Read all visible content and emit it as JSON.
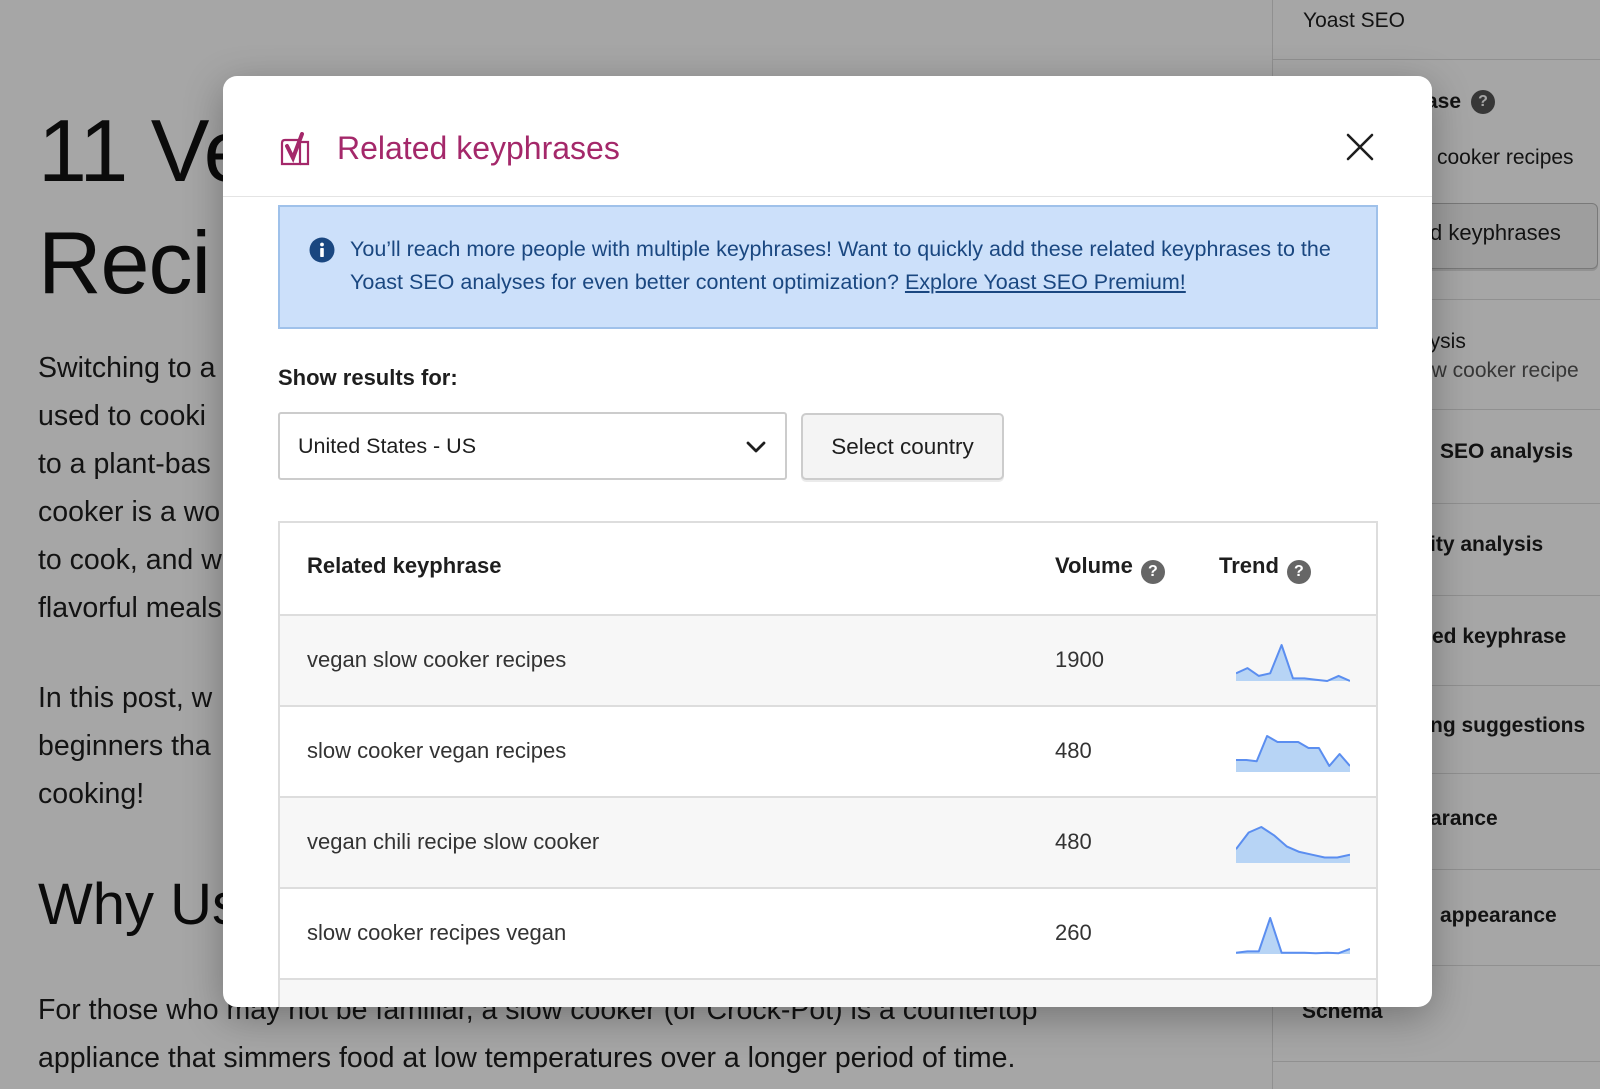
{
  "editor": {
    "title_line1": "11 Ve",
    "title_line2": "Reci",
    "p1_lines": [
      "Switching to a",
      "used to cooki",
      "to a plant-bas",
      "cooker is a wo",
      "to cook, and w",
      "flavorful meals"
    ],
    "p2_lines": [
      "In this post, w",
      "beginners tha",
      "cooking!"
    ],
    "h2": "Why Us",
    "p3_lines": [
      "For those who may not be familiar, a slow cooker (or Crock-Pot) is a countertop",
      "appliance that simmers food at low temperatures over a longer period of time."
    ]
  },
  "sidebar": {
    "header": "Yoast SEO",
    "keyphrase_label": "hrase",
    "keyphrase_value": "cooker recipes",
    "related_button": "d keyphrases",
    "analysis_label": "lysis",
    "analysis_sub": "ow cooker recipe",
    "seo_analysis": "SEO analysis",
    "readability": "ity analysis",
    "related_keyphrase": "ted keyphrase",
    "linking": "ng suggestions",
    "appearance": "arance",
    "social_appearance": "appearance",
    "schema": "Schema"
  },
  "modal": {
    "title": "Related keyphrases",
    "close_label": "Close",
    "notice_text": "You’ll reach more people with multiple keyphrases! Want to quickly add these related keyphrases to the Yoast SEO analyses for even better content optimization? ",
    "notice_link": "Explore Yoast SEO Premium!",
    "results_label": "Show results for:",
    "country_value": "United States - US",
    "select_country_button": "Select country",
    "table": {
      "headers": {
        "keyphrase": "Related keyphrase",
        "volume": "Volume",
        "trend": "Trend"
      },
      "rows": [
        {
          "keyphrase": "vegan slow cooker recipes",
          "volume": "1900",
          "trend": [
            3,
            5,
            2,
            3,
            14,
            1,
            1,
            0.5,
            0,
            2,
            0
          ]
        },
        {
          "keyphrase": "slow cooker vegan recipes",
          "volume": "480",
          "trend": [
            2,
            2,
            1.8,
            6,
            5,
            5,
            5,
            4,
            4,
            1,
            3,
            1
          ]
        },
        {
          "keyphrase": "vegan chili recipe slow cooker",
          "volume": "480",
          "trend": [
            5,
            11,
            13,
            10,
            6,
            4,
            3,
            2,
            2,
            3
          ]
        },
        {
          "keyphrase": "slow cooker recipes vegan",
          "volume": "260",
          "trend": [
            0.5,
            1,
            1,
            14,
            0.5,
            0.5,
            0.5,
            0.3,
            0.5,
            0.3,
            2
          ]
        }
      ]
    }
  },
  "colors": {
    "brand": "#a4286a",
    "notice_bg": "#cce0fa",
    "notice_text": "#1a4780",
    "spark_line": "#5b8ef0",
    "spark_fill": "#b7d4f5"
  }
}
